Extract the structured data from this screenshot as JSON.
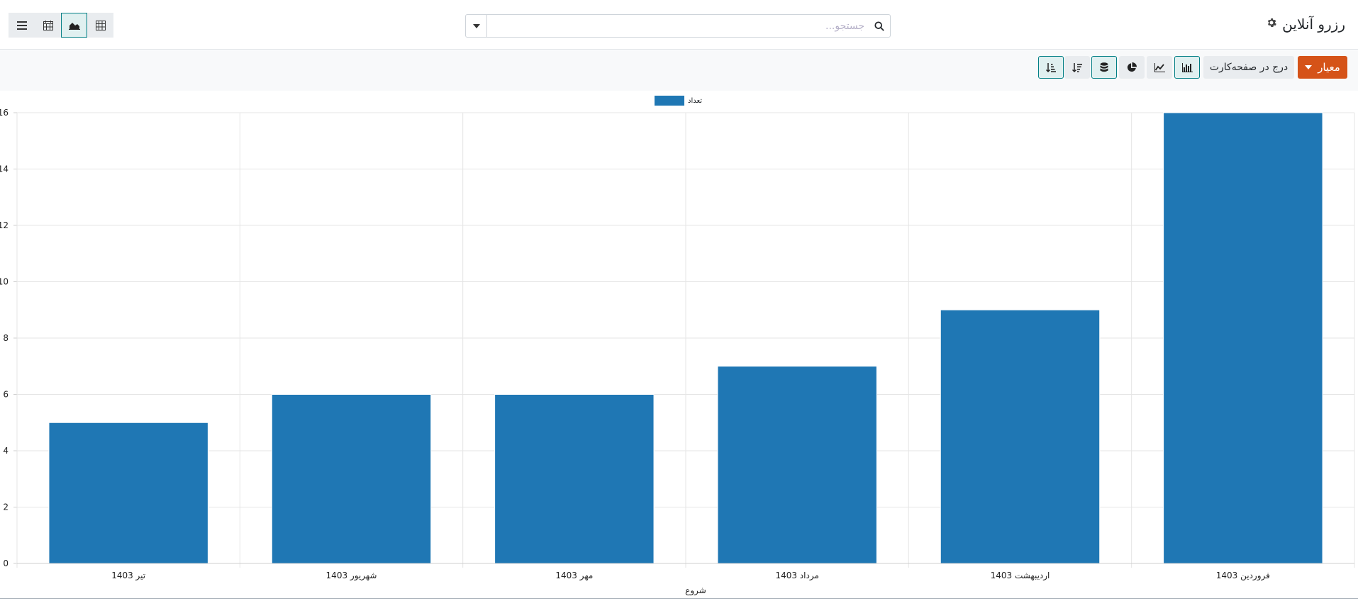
{
  "app": {
    "title": "رزرو آنلاین",
    "gear_icon": "gear-icon"
  },
  "search": {
    "placeholder": "جستجو..."
  },
  "view_switcher": [
    {
      "name": "pivot-view",
      "icon": "table-grid-icon",
      "active": false
    },
    {
      "name": "graph-view",
      "icon": "area-chart-icon",
      "active": true
    },
    {
      "name": "calendar-view",
      "icon": "calendar-icon",
      "active": false
    },
    {
      "name": "list-view",
      "icon": "list-icon",
      "active": false
    }
  ],
  "control_bar": {
    "measure_label": "معیار",
    "insert_label": "درج در صفحه‌کارت"
  },
  "chart_tools": [
    {
      "name": "bar-chart",
      "icon": "bar-chart-icon",
      "active": true
    },
    {
      "name": "line-chart",
      "icon": "line-chart-icon",
      "active": false
    },
    {
      "name": "pie-chart",
      "icon": "pie-chart-icon",
      "active": false
    },
    {
      "name": "stacked",
      "icon": "database-icon",
      "active": true
    },
    {
      "name": "sort-desc",
      "icon": "sort-descending-icon",
      "active": false
    },
    {
      "name": "sort-asc",
      "icon": "sort-ascending-icon",
      "active": true
    }
  ],
  "colors": {
    "accent": "#017e84",
    "measure_button": "#d55318",
    "bar": "#1f77b4"
  },
  "chart_data": {
    "type": "bar",
    "categories": [
      "فروردین 1403",
      "اردیبهشت 1403",
      "مرداد 1403",
      "مهر 1403",
      "شهریور 1403",
      "تیر 1403"
    ],
    "series": [
      {
        "name": "تعداد",
        "values": [
          16,
          9,
          7,
          6,
          6,
          5
        ]
      }
    ],
    "xlabel": "شروع",
    "ylabel": "",
    "ylim": [
      0,
      16
    ],
    "yticks": [
      0,
      2,
      4,
      6,
      8,
      10,
      12,
      14,
      16
    ],
    "legend": "top-center",
    "grid": true,
    "x_direction": "rtl"
  }
}
